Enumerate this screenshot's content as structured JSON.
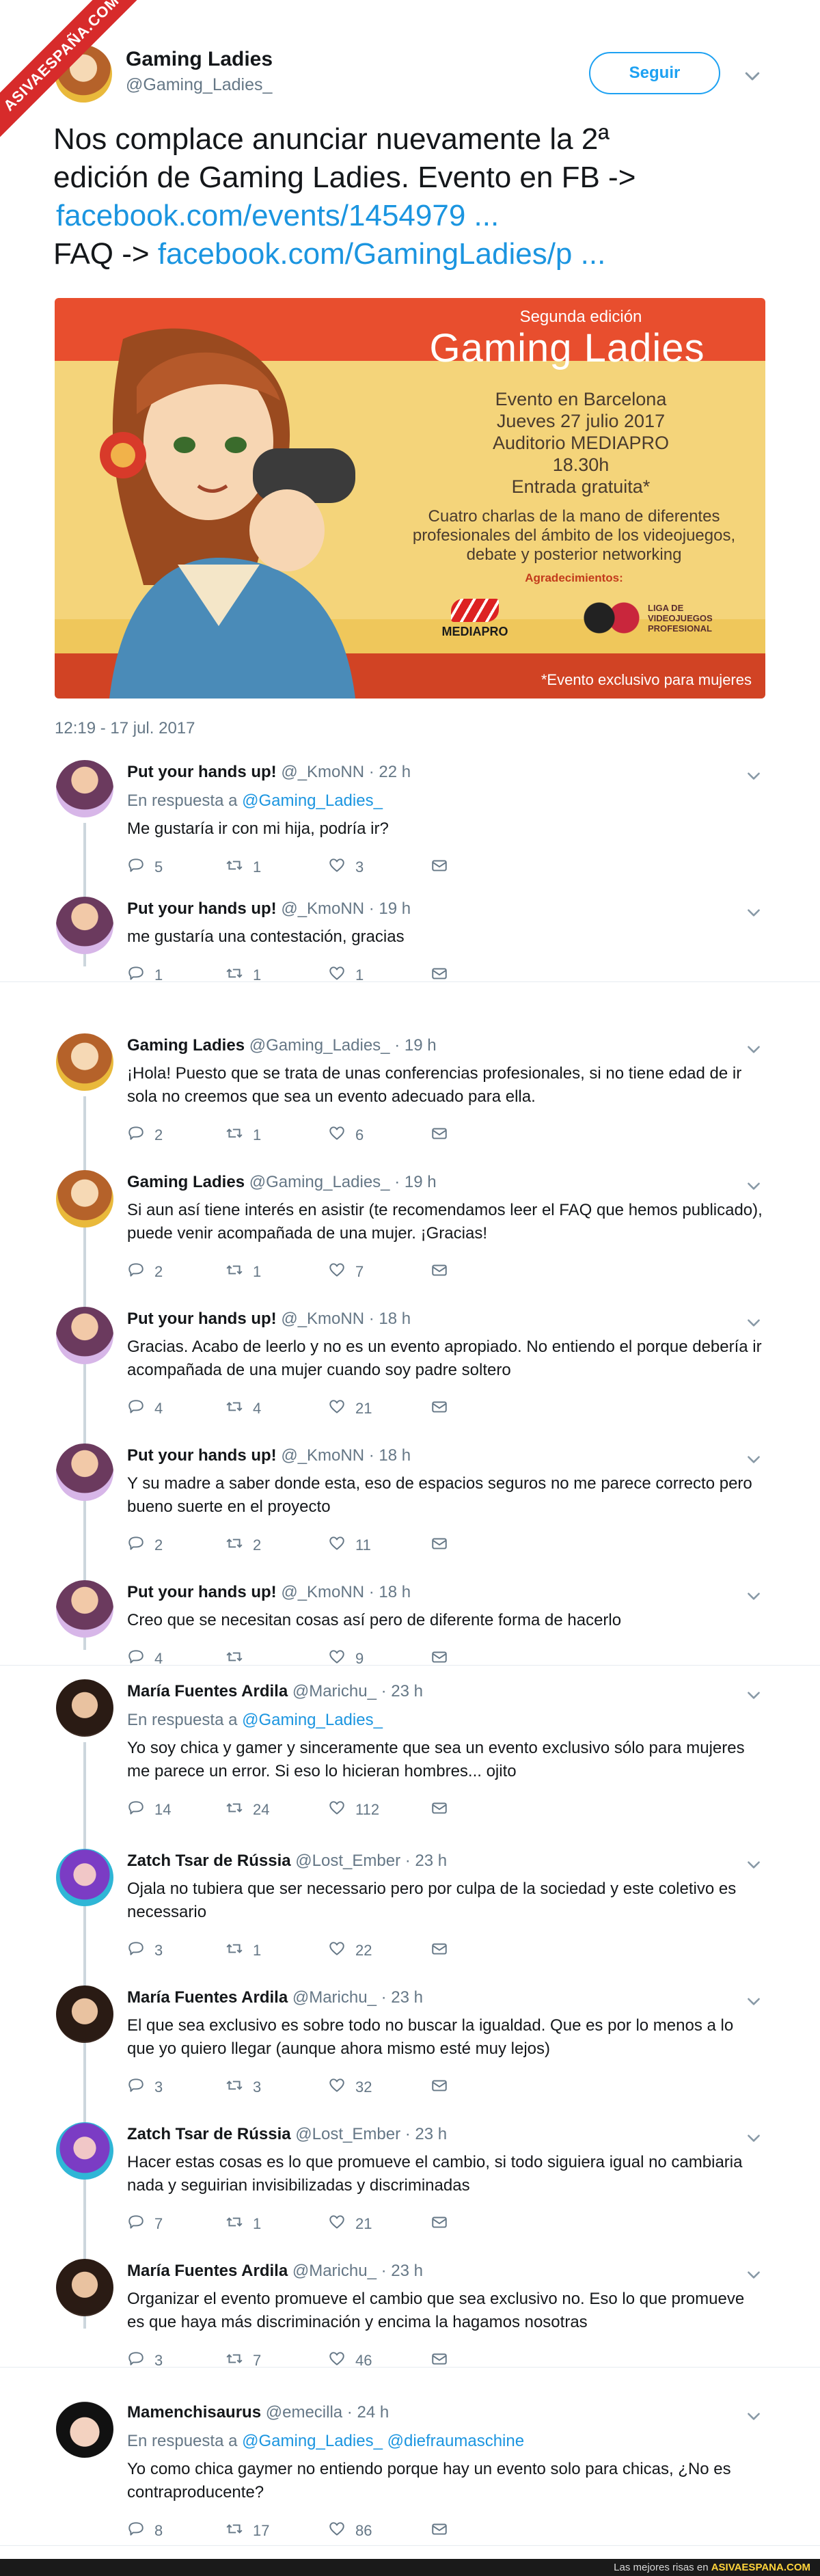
{
  "watermark": "ASIVAESPAÑA.COM",
  "main_tweet": {
    "name": "Gaming Ladies",
    "handle": "@Gaming_Ladies_",
    "follow_label": "Seguir",
    "text_line1": "Nos complace anunciar nuevamente la 2ª",
    "text_line2": "edición de Gaming Ladies. Evento en FB ->",
    "link1": "facebook.com/events/1454979 ...",
    "faq_prefix": "FAQ -> ",
    "link2": "facebook.com/GamingLadies/p ...",
    "timestamp": "12:19 - 17 jul. 2017",
    "poster": {
      "subtitle": "Segunda edición",
      "title": "Gaming Ladies",
      "line1": "Evento en Barcelona",
      "line2": "Jueves 27 julio 2017",
      "line3": "Auditorio MEDIAPRO",
      "line4": "18.30h",
      "line5": "Entrada gratuita*",
      "desc1": "Cuatro charlas de la mano de diferentes",
      "desc2": "profesionales del ámbito de los videojuegos,",
      "desc3": "debate y posterior networking",
      "thanks": "Agradecimientos:",
      "sponsor1": "MEDIAPRO",
      "sponsor2a": "LIGA DE",
      "sponsor2b": "VIDEOJUEGOS",
      "sponsor2c": "PROFESIONAL",
      "footnote": "*Evento exclusivo para mujeres"
    }
  },
  "replies": [
    {
      "name": "Put your hands up!",
      "meta": " @_KmoNN · 22 h",
      "in_reply": "En respuesta a ",
      "mention": "@Gaming_Ladies_",
      "mention2": "",
      "text": "Me gustaría ir con mi hija, podría ir?",
      "replies": "5",
      "retweets": "1",
      "likes": "3"
    },
    {
      "name": "Put your hands up!",
      "meta": " @_KmoNN · 19 h",
      "text": "me gustaría una contestación, gracias",
      "replies": "1",
      "retweets": "1",
      "likes": "1"
    },
    {
      "name": "Gaming Ladies",
      "meta": " @Gaming_Ladies_ · 19 h",
      "text": "¡Hola! Puesto que se trata de unas conferencias profesionales, si no tiene edad de ir sola no creemos que sea un evento adecuado para ella.",
      "replies": "2",
      "retweets": "1",
      "likes": "6"
    },
    {
      "name": "Gaming Ladies",
      "meta": " @Gaming_Ladies_ · 19 h",
      "text": "Si aun así tiene interés en asistir (te recomendamos leer el FAQ que hemos publicado), puede venir acompañada de una mujer. ¡Gracias!",
      "replies": "2",
      "retweets": "1",
      "likes": "7"
    },
    {
      "name": "Put your hands up!",
      "meta": " @_KmoNN · 18 h",
      "text": "Gracias. Acabo de leerlo y no es un evento apropiado. No entiendo el porque debería ir acompañada de una mujer cuando soy padre soltero",
      "replies": "4",
      "retweets": "4",
      "likes": "21"
    },
    {
      "name": "Put your hands up!",
      "meta": " @_KmoNN · 18 h",
      "text": "Y su madre a saber donde esta, eso de espacios seguros no me parece correcto pero bueno suerte en el proyecto",
      "replies": "2",
      "retweets": "2",
      "likes": "11"
    },
    {
      "name": "Put your hands up!",
      "meta": " @_KmoNN · 18 h",
      "text": "Creo que se necesitan cosas así pero de diferente forma de hacerlo",
      "replies": "4",
      "retweets": "",
      "likes": "9"
    },
    {
      "name": "María Fuentes Ardila",
      "meta": " @Marichu_ · 23 h",
      "in_reply": "En respuesta a ",
      "mention": "@Gaming_Ladies_",
      "mention2": "",
      "text": "Yo soy chica y gamer y sinceramente que sea un evento exclusivo sólo para mujeres me parece un error. Si eso lo hicieran hombres... ojito",
      "replies": "14",
      "retweets": "24",
      "likes": "112"
    },
    {
      "name": "Zatch Tsar de Rússia",
      "meta": " @Lost_Ember · 23 h",
      "text": "Ojala no tubiera que ser necessario pero por culpa de la sociedad y este coletivo es necessario",
      "replies": "3",
      "retweets": "1",
      "likes": "22"
    },
    {
      "name": "María Fuentes Ardila",
      "meta": " @Marichu_ · 23 h",
      "text": "El que sea exclusivo es sobre todo no buscar la igualdad. Que es por lo menos a lo que yo quiero llegar (aunque ahora mismo esté muy lejos)",
      "replies": "3",
      "retweets": "3",
      "likes": "32"
    },
    {
      "name": "Zatch Tsar de Rússia",
      "meta": " @Lost_Ember · 23 h",
      "text": "Hacer estas cosas es lo que promueve el cambio,  si todo siguiera igual no cambiaria nada y seguirian invisibilizadas y discriminadas",
      "replies": "7",
      "retweets": "1",
      "likes": "21"
    },
    {
      "name": "María Fuentes Ardila",
      "meta": " @Marichu_ · 23 h",
      "text": "Organizar el evento promueve el cambio que sea exclusivo no. Eso lo que promueve es que haya más discriminación y encima la hagamos nosotras",
      "replies": "3",
      "retweets": "7",
      "likes": "46"
    },
    {
      "name": "Mamenchisaurus",
      "meta": " @emecilla · 24 h",
      "in_reply": "En respuesta a ",
      "mention": "@Gaming_Ladies_",
      "mention2": " @diefraumaschine",
      "text": "Yo como chica gaymer no entiendo porque hay un evento solo para chicas, ¿No es contraproducente?",
      "replies": "8",
      "retweets": "17",
      "likes": "86"
    }
  ],
  "footer": {
    "prefix": "Las mejores risas en ",
    "brand": "ASIVAESPANA.COM"
  },
  "colors": {
    "accent": "#1da1f2",
    "link": "#1b95e0",
    "muted": "#657786",
    "ribbon": "#d72b2b"
  }
}
